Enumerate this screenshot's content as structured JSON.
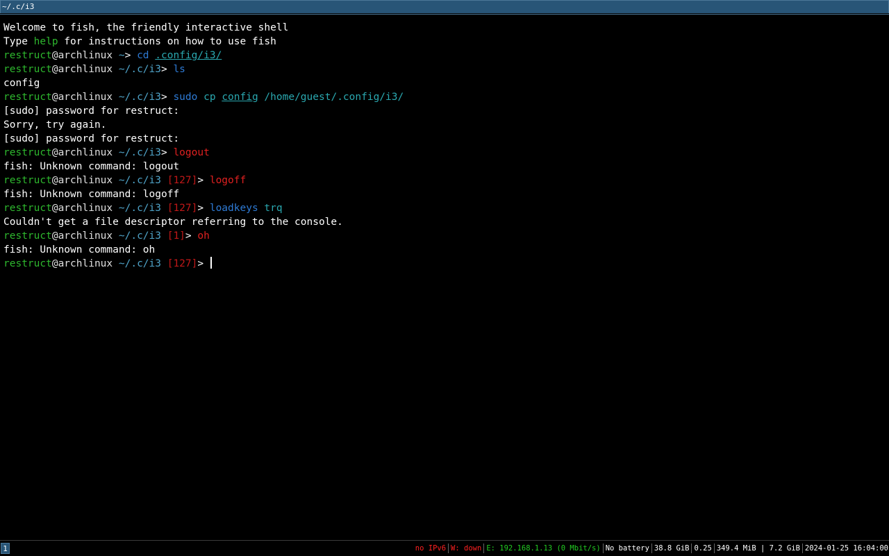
{
  "window": {
    "title": "~/.c/i3"
  },
  "terminal": {
    "lines": [
      [
        {
          "t": "Welcome to fish, the friendly interactive shell",
          "c": "s"
        }
      ],
      [
        {
          "t": "Type ",
          "c": "s"
        },
        {
          "t": "help",
          "c": "help"
        },
        {
          "t": " for instructions on how to use fish",
          "c": "s"
        }
      ],
      [
        {
          "t": "restruct",
          "c": "u"
        },
        {
          "t": "@archlinux ",
          "c": "w"
        },
        {
          "t": "~",
          "c": "p"
        },
        {
          "t": "> ",
          "c": "s"
        },
        {
          "t": "cd",
          "c": "cmd"
        },
        {
          "t": " ",
          "c": "s"
        },
        {
          "t": ".config/i3/",
          "c": "argu"
        }
      ],
      [
        {
          "t": "restruct",
          "c": "u"
        },
        {
          "t": "@archlinux ",
          "c": "w"
        },
        {
          "t": "~/.c/i3",
          "c": "p"
        },
        {
          "t": "> ",
          "c": "s"
        },
        {
          "t": "ls",
          "c": "cmd"
        }
      ],
      [
        {
          "t": "config",
          "c": "s"
        }
      ],
      [
        {
          "t": "restruct",
          "c": "u"
        },
        {
          "t": "@archlinux ",
          "c": "w"
        },
        {
          "t": "~/.c/i3",
          "c": "p"
        },
        {
          "t": "> ",
          "c": "s"
        },
        {
          "t": "sudo",
          "c": "cmd"
        },
        {
          "t": " ",
          "c": "s"
        },
        {
          "t": "cp",
          "c": "arg"
        },
        {
          "t": " ",
          "c": "s"
        },
        {
          "t": "config",
          "c": "argu"
        },
        {
          "t": " /home/guest/.config/i3/",
          "c": "arg"
        }
      ],
      [
        {
          "t": "[sudo] password for restruct:",
          "c": "s"
        }
      ],
      [
        {
          "t": "Sorry, try again.",
          "c": "s"
        }
      ],
      [
        {
          "t": "[sudo] password for restruct:",
          "c": "s"
        }
      ],
      [
        {
          "t": "restruct",
          "c": "u"
        },
        {
          "t": "@archlinux ",
          "c": "w"
        },
        {
          "t": "~/.c/i3",
          "c": "p"
        },
        {
          "t": "> ",
          "c": "s"
        },
        {
          "t": "logout",
          "c": "bad"
        }
      ],
      [
        {
          "t": "fish: Unknown command: logout",
          "c": "s"
        }
      ],
      [
        {
          "t": "restruct",
          "c": "u"
        },
        {
          "t": "@archlinux ",
          "c": "w"
        },
        {
          "t": "~/.c/i3 ",
          "c": "p"
        },
        {
          "t": "[127]",
          "c": "st"
        },
        {
          "t": "> ",
          "c": "s"
        },
        {
          "t": "logoff",
          "c": "bad"
        }
      ],
      [
        {
          "t": "fish: Unknown command: logoff",
          "c": "s"
        }
      ],
      [
        {
          "t": "restruct",
          "c": "u"
        },
        {
          "t": "@archlinux ",
          "c": "w"
        },
        {
          "t": "~/.c/i3 ",
          "c": "p"
        },
        {
          "t": "[127]",
          "c": "st"
        },
        {
          "t": "> ",
          "c": "s"
        },
        {
          "t": "loadkeys",
          "c": "cmd"
        },
        {
          "t": " ",
          "c": "s"
        },
        {
          "t": "trq",
          "c": "arg"
        }
      ],
      [
        {
          "t": "Couldn't get a file descriptor referring to the console.",
          "c": "s"
        }
      ],
      [
        {
          "t": "restruct",
          "c": "u"
        },
        {
          "t": "@archlinux ",
          "c": "w"
        },
        {
          "t": "~/.c/i3 ",
          "c": "p"
        },
        {
          "t": "[1]",
          "c": "st"
        },
        {
          "t": "> ",
          "c": "s"
        },
        {
          "t": "oh",
          "c": "bad"
        }
      ],
      [
        {
          "t": "fish: Unknown command: oh",
          "c": "s"
        }
      ],
      [
        {
          "t": "restruct",
          "c": "u"
        },
        {
          "t": "@archlinux ",
          "c": "w"
        },
        {
          "t": "~/.c/i3 ",
          "c": "p"
        },
        {
          "t": "[127]",
          "c": "st"
        },
        {
          "t": "> ",
          "c": "s"
        }
      ]
    ]
  },
  "statusbar": {
    "workspace": "1",
    "items": [
      {
        "t": "no IPv6",
        "c": "red"
      },
      {
        "t": "W: down",
        "c": "red"
      },
      {
        "t": "E: 192.168.1.13 (0 Mbit/s)",
        "c": "green"
      },
      {
        "t": "No battery",
        "c": "white"
      },
      {
        "t": "38.8 GiB",
        "c": "white"
      },
      {
        "t": "0.25",
        "c": "white"
      },
      {
        "t": "349.4 MiB | 7.2 GiB",
        "c": "white"
      },
      {
        "t": "2024-01-25 16:04:00",
        "c": "white"
      }
    ]
  },
  "colors": {
    "title_bg": "#285577",
    "user": "#2eb82e",
    "command": "#2e7bd6",
    "error": "#e02020"
  }
}
